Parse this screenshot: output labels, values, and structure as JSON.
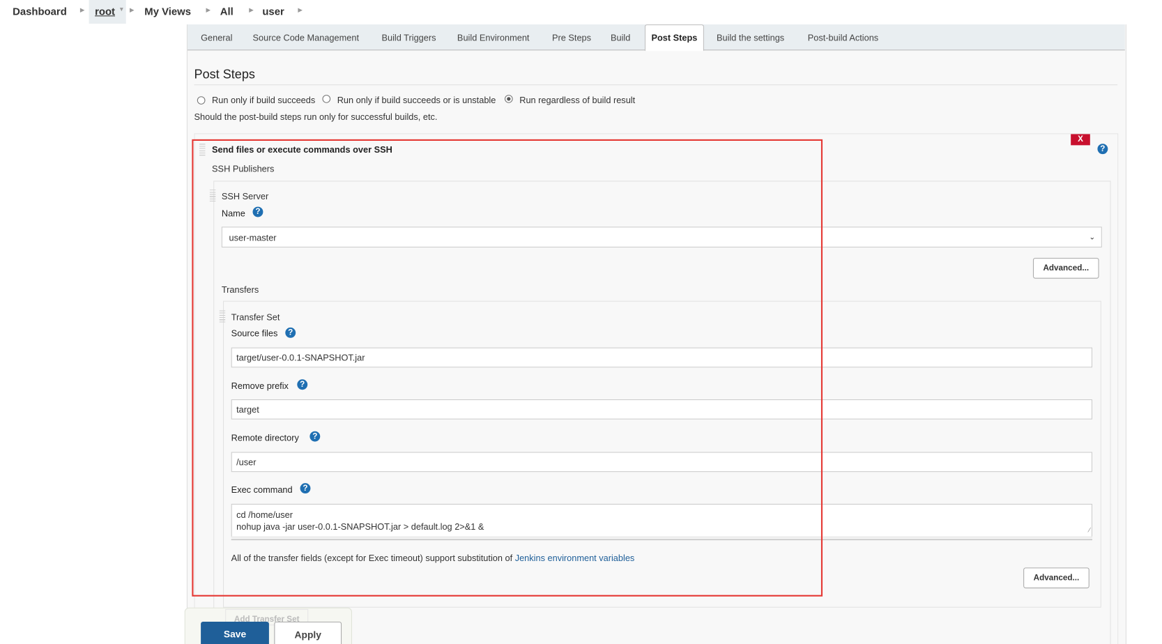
{
  "breadcrumb": [
    "Dashboard",
    "root",
    "My Views",
    "All",
    "user"
  ],
  "tabs": [
    "General",
    "Source Code Management",
    "Build Triggers",
    "Build Environment",
    "Pre Steps",
    "Build",
    "Post Steps",
    "Build the settings",
    "Post-build Actions"
  ],
  "active_tab": "Post Steps",
  "section": {
    "title": "Post Steps",
    "options": [
      "Run only if build succeeds",
      "Run only if build succeeds or is unstable",
      "Run regardless of build result"
    ],
    "selected_option": "Run regardless of build result",
    "description": "Should the post-build steps run only for successful builds, etc."
  },
  "ssh": {
    "title": "Send files or execute commands over SSH",
    "delete_label": "X",
    "publishers_label": "SSH Publishers",
    "server_label": "SSH Server",
    "name_label": "Name",
    "name_value": "user-master",
    "advanced_label": "Advanced...",
    "transfers_label": "Transfers",
    "transfer_set_label": "Transfer Set",
    "source_files_label": "Source files",
    "source_files_value": "target/user-0.0.1-SNAPSHOT.jar",
    "remove_prefix_label": "Remove prefix",
    "remove_prefix_value": "target",
    "remote_dir_label": "Remote directory",
    "remote_dir_value": "/user",
    "exec_label": "Exec command",
    "exec_line1": "cd /home/user",
    "exec_line2": "nohup java -jar user-0.0.1-SNAPSHOT.jar > default.log 2>&1 &",
    "note": "All of the transfer fields (except for Exec timeout) support substitution of ",
    "note_link": "Jenkins environment variables",
    "add_transfer_set": "Add Transfer Set"
  },
  "footer": {
    "save": "Save",
    "apply": "Apply"
  },
  "colors": {
    "highlight": "#e53935",
    "primary": "#1f5f99",
    "link": "#1f5f99"
  }
}
